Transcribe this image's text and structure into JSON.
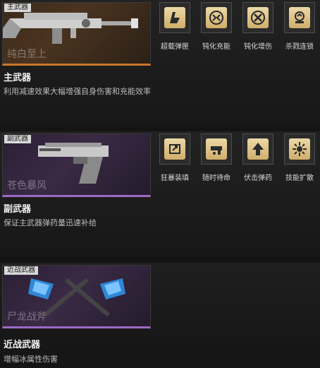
{
  "sections": [
    {
      "slot": "主武器",
      "weapon_name": "纯白至上",
      "title": "主武器",
      "description": "利用减速效果大幅增强自身伤害和充能效率",
      "skills": [
        {
          "label": "超载弹匣",
          "icon": "ammo-boost-icon"
        },
        {
          "label": "钝化充能",
          "icon": "charge-icon"
        },
        {
          "label": "钝化增伤",
          "icon": "cross-blades-icon"
        },
        {
          "label": "杀戮连锁",
          "icon": "chain-icon"
        }
      ]
    },
    {
      "slot": "副武器",
      "weapon_name": "苍色暴风",
      "title": "副武器",
      "description": "保证主武器弹药量迅速补给",
      "skills": [
        {
          "label": "狂暴装填",
          "icon": "reload-icon"
        },
        {
          "label": "随时待命",
          "icon": "standby-icon"
        },
        {
          "label": "伏击弹药",
          "icon": "arrow-up-icon"
        },
        {
          "label": "技能扩散",
          "icon": "burst-icon"
        }
      ]
    },
    {
      "slot": "近战武器",
      "weapon_name": "尸龙战斧",
      "title": "近战武器",
      "description": "增幅冰属性伤害",
      "skills": []
    }
  ]
}
